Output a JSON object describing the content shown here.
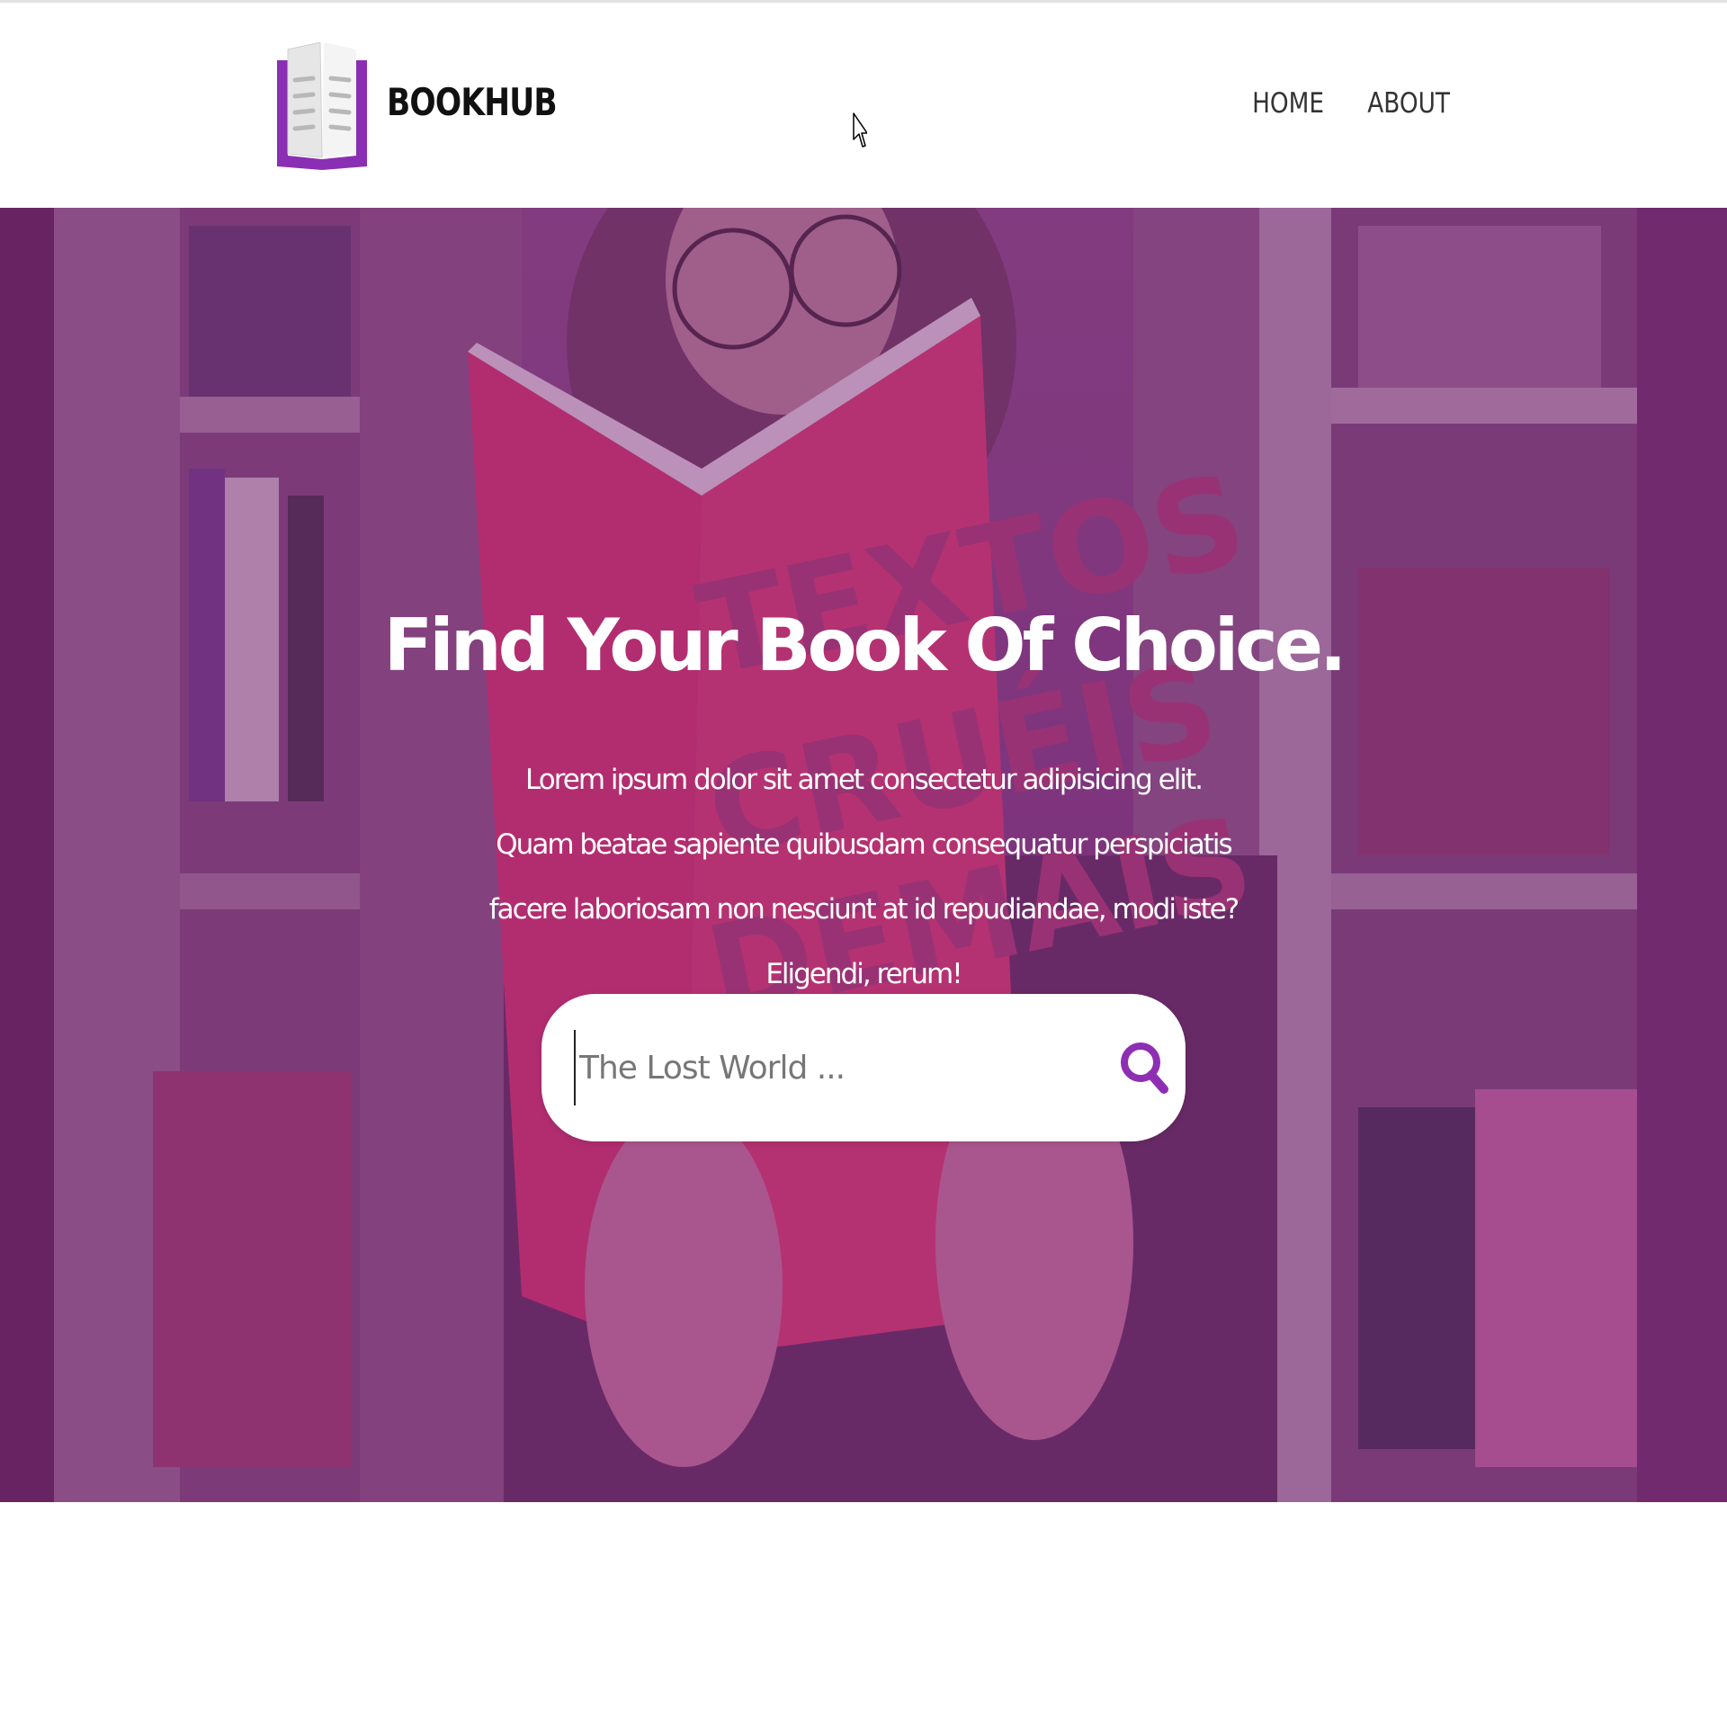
{
  "header": {
    "brand": "BOOKHUB",
    "nav": [
      {
        "label": "HOME"
      },
      {
        "label": "ABOUT"
      }
    ]
  },
  "hero": {
    "title": "Find Your Book Of Choice.",
    "description": "Lorem ipsum dolor sit amet consectetur adipisicing elit. Quam beatae sapiente quibusdam consequatur perspiciatis facere laboriosam non nesciunt at id repudiandae, modi iste? Eligendi, rerum!",
    "search": {
      "placeholder": "The Lost World ...",
      "value": ""
    }
  },
  "colors": {
    "accent": "#8e2fb3",
    "overlay": "#7a2a78",
    "text_dark": "#111111"
  },
  "icons": {
    "logo": "book-logo-icon",
    "search": "search-icon",
    "cursor": "mouse-pointer-icon"
  }
}
